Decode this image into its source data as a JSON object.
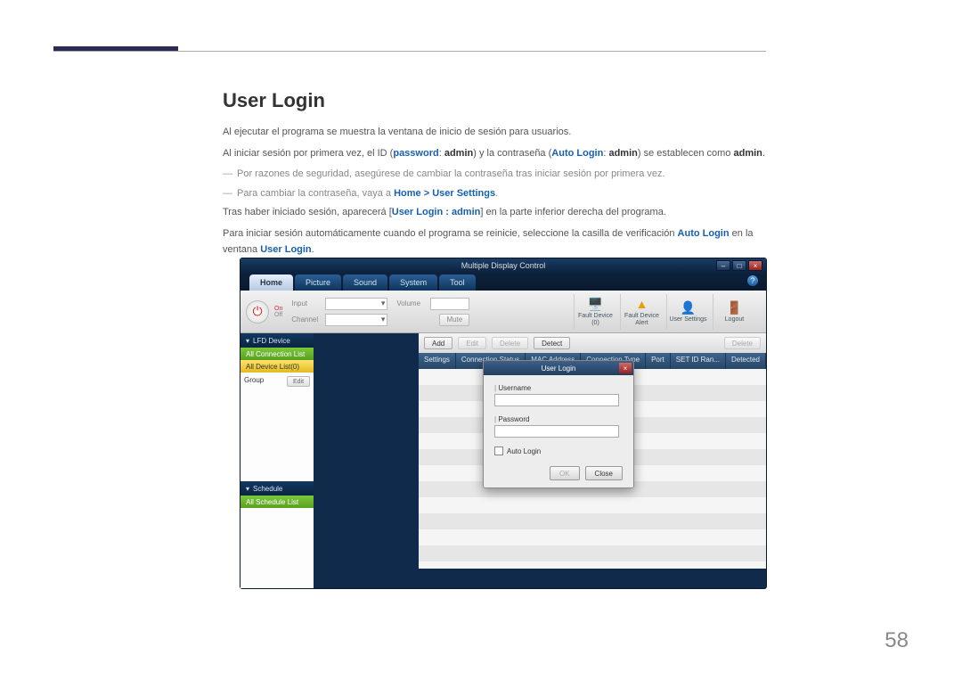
{
  "doc": {
    "heading": "User Login",
    "p1_a": "Al ejecutar el programa se muestra la ventana de inicio de sesión para usuarios.",
    "p2_a": "Al iniciar sesión por primera vez, el ID (",
    "p2_pw": "password",
    "p2_b": ": ",
    "p2_admin1": "admin",
    "p2_c": ") y la contraseña (",
    "p2_autologin": "Auto Login",
    "p2_d": ": ",
    "p2_admin2": "admin",
    "p2_e": ") se establecen como ",
    "p2_admin3": "admin",
    "p2_f": ".",
    "note1": "Por razones de seguridad, asegúrese de cambiar la contraseña tras iniciar sesión por primera vez.",
    "note2_a": "Para cambiar la contraseña, vaya a ",
    "note2_link": "Home > User Settings",
    "note2_b": ".",
    "p3_a": "Tras haber iniciado sesión, aparecerá [",
    "p3_link": "User Login : admin",
    "p3_b": "] en la parte inferior derecha del programa.",
    "p4_a": "Para iniciar sesión automáticamente cuando el programa se reinicie, seleccione la casilla de verificación ",
    "p4_link1": "Auto Login",
    "p4_b": " en la ventana ",
    "p4_link2": "User Login",
    "p4_c": ".",
    "page_number": "58"
  },
  "app": {
    "title": "Multiple Display Control",
    "tabs": {
      "home": "Home",
      "picture": "Picture",
      "sound": "Sound",
      "system": "System",
      "tool": "Tool"
    },
    "help": "?",
    "toolbar": {
      "on": "On",
      "off": "Off",
      "input": "Input",
      "channel": "Channel",
      "volume": "Volume",
      "mute": "Mute"
    },
    "big_icons": {
      "fault_device": "Fault Device\n(0)",
      "fault_alert": "Fault Device\nAlert",
      "user_settings": "User Settings",
      "logout": "Logout"
    },
    "sidebar": {
      "lfd_header": "LFD Device",
      "all_conn": "All Connection List",
      "all_dev": "All Device List(0)",
      "group": "Group",
      "edit": "Edit",
      "schedule_header": "Schedule",
      "all_schedule": "All Schedule List"
    },
    "actions": {
      "add": "Add",
      "edit": "Edit",
      "delete": "Delete",
      "detect": "Detect",
      "delete2": "Delete"
    },
    "columns": {
      "settings": "Settings",
      "conn_status": "Connection Status",
      "mac": "MAC Address",
      "conn_type": "Connection Type",
      "port": "Port",
      "setid": "SET ID Ran...",
      "detected": "Detected"
    },
    "dialog": {
      "title": "User Login",
      "username": "Username",
      "password": "Password",
      "auto_login": "Auto Login",
      "ok": "OK",
      "close": "Close"
    }
  }
}
